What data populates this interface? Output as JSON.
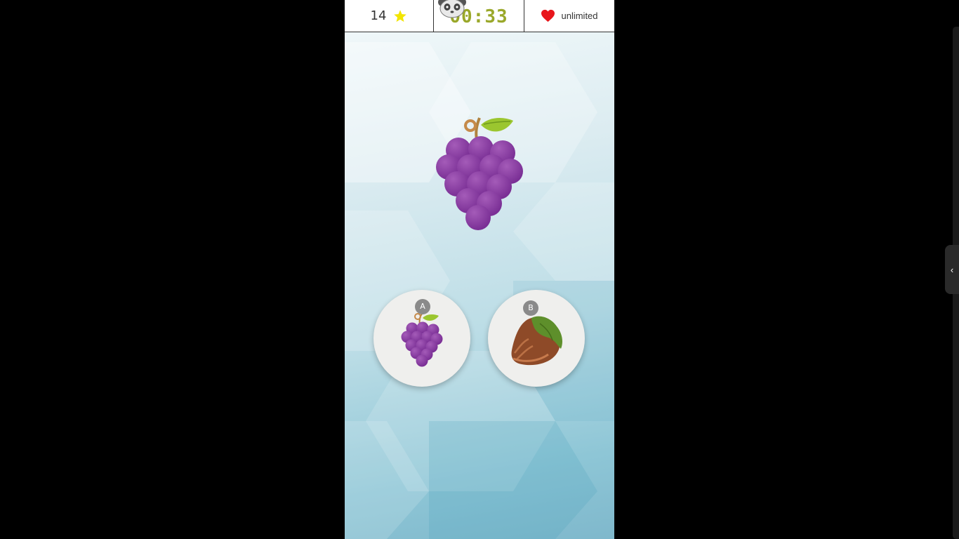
{
  "hud": {
    "score": "14",
    "timer": "00:33",
    "lives": "unlimited",
    "icons": {
      "score": "star-icon",
      "timer": "panda-icon",
      "lives": "heart-icon"
    },
    "colors": {
      "star": "#f2e500",
      "timer": "#9aa82a",
      "heart": "#e8161b"
    }
  },
  "question": {
    "image": "grapes"
  },
  "choices": [
    {
      "letter": "A",
      "image": "grapes"
    },
    {
      "letter": "B",
      "image": "hazelnut"
    }
  ],
  "side_panel": {
    "toggle_icon": "chevron-left-icon",
    "toggle_glyph": "‹"
  }
}
